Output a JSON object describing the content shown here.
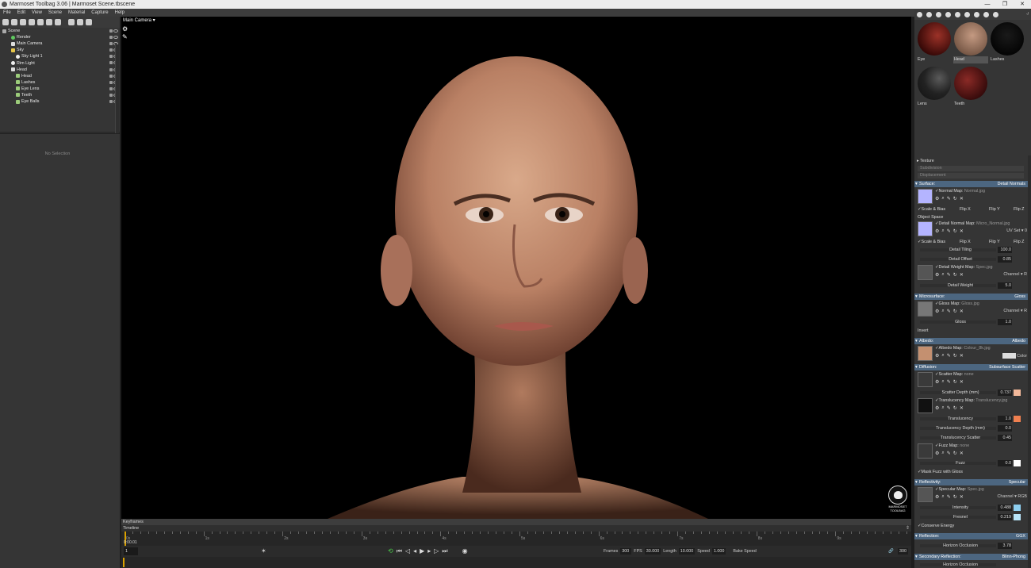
{
  "window": {
    "title": "Marmoset Toolbag 3.06  |  Marmoset Scene.tbscene",
    "controls": [
      "—",
      "❐",
      "✕"
    ]
  },
  "menu": [
    "File",
    "Edit",
    "View",
    "Scene",
    "Material",
    "Capture",
    "Help"
  ],
  "outliner": {
    "items": [
      {
        "label": "Scene"
      },
      {
        "label": "Render"
      },
      {
        "label": "Main Camera"
      },
      {
        "label": "Sky"
      },
      {
        "label": "Sky Light 1"
      },
      {
        "label": "Rim Light"
      },
      {
        "label": "Head"
      },
      {
        "label": "Head"
      },
      {
        "label": "Lashes"
      },
      {
        "label": "Eye Lens"
      },
      {
        "label": "Teeth"
      },
      {
        "label": "Eye Balls"
      }
    ]
  },
  "properties": {
    "empty_text": "No Selection"
  },
  "viewport": {
    "camera_label": "Main Camera ▾",
    "logo_lines": [
      "MARMOSET",
      "TOOLBAG"
    ]
  },
  "timeline": {
    "keyframes_label": "Keyframes",
    "timeline_label": "Timeline",
    "current_time": "0:00.01",
    "tick_labels": [
      "0s",
      "1s",
      "2s",
      "3s",
      "4s",
      "5s",
      "6s",
      "7s",
      "8s",
      "9s"
    ],
    "frame": "1",
    "frames_label": "Frames",
    "frames_value": "300",
    "fps_label": "FPS",
    "fps_value": "30.000",
    "length_label": "Length",
    "length_value": "10.000",
    "speed_label": "Speed",
    "speed_value": "1.000",
    "bake_label": "Bake Speed",
    "end_value": "300"
  },
  "materials": {
    "toolbar_right": "-/",
    "swatches": [
      {
        "name": "Eye",
        "color": "#7a1a14"
      },
      {
        "name": "Head",
        "color": "#b08a72"
      },
      {
        "name": "Lashes",
        "color": "#0d0d0d"
      },
      {
        "name": "Lens",
        "color": "#1c1c1c"
      },
      {
        "name": "Teeth",
        "color": "#6a1a1a"
      }
    ],
    "selected": "Head"
  },
  "editor": {
    "texture": "Texture",
    "subdivision": "Subdivision",
    "displacement": "Displacement",
    "surface": {
      "title": "Surface:",
      "value": "Detail Normals",
      "normal_map": "Normal Map:",
      "normal_file": "Normal.jpg",
      "scale_bias": "Scale & Bias",
      "flip_x": "Flip X",
      "flip_y": "Flip Y",
      "flip_z": "Flip Z",
      "object_space": "Object Space",
      "detail_normal_map": "Detail Normal Map:",
      "detail_normal_file": "Micro_Normal.jpg",
      "uv_set": "UV Set ▾  0",
      "detail_tiling": "Detail Tiling",
      "detail_tiling_val": "100.0",
      "detail_offset": "Detail Offset",
      "detail_offset_val": "0.85",
      "detail_weight_map": "Detail Weight Map:",
      "detail_weight_file": "Spec.jpg",
      "channel_r": "Channel ▾  R",
      "detail_weight": "Detail Weight",
      "detail_weight_val": "5.0"
    },
    "microsurface": {
      "title": "Microsurface:",
      "value": "Gloss",
      "gloss_map": "Gloss Map:",
      "gloss_file": "Gloss.jpg",
      "channel": "Channel ▾  R",
      "gloss": "Gloss",
      "gloss_val": "1.0",
      "invert": "Invert"
    },
    "albedo": {
      "title": "Albedo:",
      "value": "Albedo",
      "albedo_map": "Albedo Map:",
      "albedo_file": "Colour_8k.jpg",
      "color": "Color"
    },
    "diffusion": {
      "title": "Diffusion:",
      "value": "Subsurface Scatter",
      "scatter_map": "Scatter Map:",
      "scatter_file": "none",
      "scatter_depth": "Scatter Depth (mm)",
      "scatter_depth_val": "0.737",
      "translucency_map": "Translucency Map:",
      "translucency_file": "Translucency.jpg",
      "translucency": "Translucency",
      "translucency_val": "1.0",
      "translucency_depth": "Translucency Depth (mm)",
      "translucency_depth_val": "0.0",
      "translucency_scatter": "Translucency Scatter",
      "translucency_scatter_val": "0.45",
      "fuzz_map": "Fuzz Map:",
      "fuzz_file": "none",
      "fuzz": "Fuzz",
      "fuzz_val": "0.0",
      "mask_fuzz": "Mask Fuzz with Gloss"
    },
    "reflectivity": {
      "title": "Reflectivity:",
      "value": "Specular",
      "specular_map": "Specular Map:",
      "specular_file": "Spec.jpg",
      "channel": "Channel ▾  RGB",
      "intensity": "Intensity",
      "intensity_val": "0.488",
      "fresnel": "Fresnel",
      "fresnel_val": "0.219",
      "conserve": "Conserve Energy"
    },
    "reflection": {
      "title": "Reflection:",
      "value": "GGX",
      "horizon": "Horizon Occlusion",
      "horizon_val": "3.78"
    },
    "secondary": {
      "title": "Secondary Reflection:",
      "value": "Blinn-Phong",
      "cut": "Horizon Occlusion"
    }
  }
}
